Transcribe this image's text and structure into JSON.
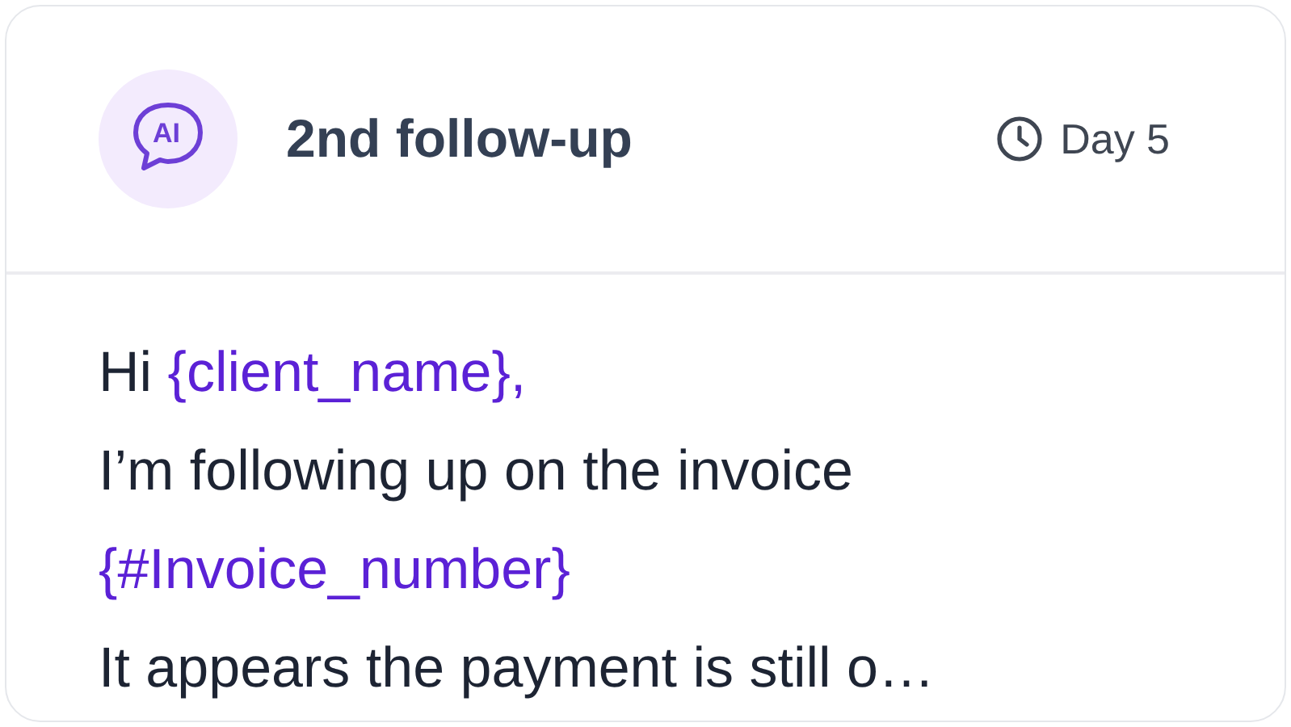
{
  "header": {
    "icon_label": "AI",
    "title": "2nd follow-up",
    "delay": "Day 5"
  },
  "message": [
    [
      {
        "kind": "text",
        "text": "Hi "
      },
      {
        "kind": "variable",
        "text": "{client_name},"
      }
    ],
    [
      {
        "kind": "text",
        "text": "I’m following up on the invoice"
      }
    ],
    [
      {
        "kind": "variable",
        "text": "{#Invoice_number}"
      }
    ],
    [
      {
        "kind": "text",
        "text": "It appears the payment is still o…"
      }
    ]
  ]
}
